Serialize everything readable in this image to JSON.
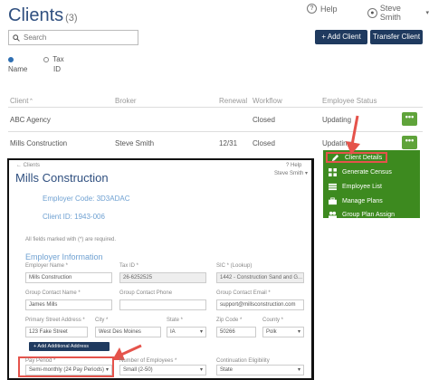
{
  "page": {
    "title": "Clients",
    "count": "(3)",
    "help": "Help",
    "user": "Steve Smith"
  },
  "search": {
    "placeholder": "Search"
  },
  "buttons": {
    "add_client": "+ Add Client",
    "transfer_client": "Transfer Client"
  },
  "radios": [
    {
      "label": "Name",
      "selected": true
    },
    {
      "label": "Tax ID",
      "selected": false
    }
  ],
  "table": {
    "columns": [
      "Client",
      "Broker",
      "Renewal",
      "Workflow",
      "Employee Status"
    ],
    "rows": [
      {
        "client": "ABC Agency",
        "broker": "",
        "renewal": "",
        "workflow": "Closed",
        "status": "Updating",
        "action": "•••"
      },
      {
        "client": "Mills Construction",
        "broker": "Steve Smith",
        "renewal": "12/31",
        "workflow": "Closed",
        "status": "Updating",
        "action": "•••"
      }
    ]
  },
  "menu": {
    "items": [
      {
        "label": "Client Details",
        "icon": "pencil-icon"
      },
      {
        "label": "Generate Census",
        "icon": "grid-icon"
      },
      {
        "label": "Employee List",
        "icon": "list-icon"
      },
      {
        "label": "Manage Plans",
        "icon": "briefcase-icon"
      },
      {
        "label": "Group Plan Assign",
        "icon": "users-icon"
      }
    ]
  },
  "card": {
    "crumb": "← Clients",
    "title": "Mills Construction",
    "help": "? Help",
    "user": "Steve Smith ▾",
    "employer_code": "Employer Code: 3D3ADAC",
    "client_id": "Client ID: 1943-006",
    "required_note": "All fields marked with (*) are required.",
    "section": "Employer Information",
    "fields": {
      "employer_name": {
        "label": "Employer Name *",
        "value": "Mills Construction"
      },
      "tax_id": {
        "label": "Tax ID *",
        "value": "26-6252525"
      },
      "sic": {
        "label": "SIC * (Lookup)",
        "value": "1442 - Construction Sand and G..."
      },
      "group_contact_name": {
        "label": "Group Contact Name *",
        "value": "James Mills"
      },
      "group_contact_phone": {
        "label": "Group Contact Phone",
        "value": ""
      },
      "group_contact_email": {
        "label": "Group Contact Email *",
        "value": "support@millsconstruction.com"
      },
      "primary_street": {
        "label": "Primary Street Address *",
        "value": "123 Fake Street"
      },
      "city": {
        "label": "City *",
        "value": "West Des Moines"
      },
      "state": {
        "label": "State *",
        "value": "IA"
      },
      "zip": {
        "label": "Zip Code *",
        "value": "50266"
      },
      "county": {
        "label": "County *",
        "value": "Polk"
      },
      "pay_period": {
        "label": "Pay Period *",
        "value": "Semi-monthly (24 Pay Periods)"
      },
      "num_employees": {
        "label": "Number of Employees *",
        "value": "Small (2-50)"
      },
      "continuation": {
        "label": "Continuation Eligibility",
        "value": "State"
      }
    },
    "add_address": "+ Add Additional Address"
  },
  "colors": {
    "brand_navy": "#1f3a5f",
    "action_green": "#5fa33a",
    "menu_green": "#3d8a1f",
    "highlight_red": "#e5534b",
    "link_blue": "#6fa1d2"
  }
}
